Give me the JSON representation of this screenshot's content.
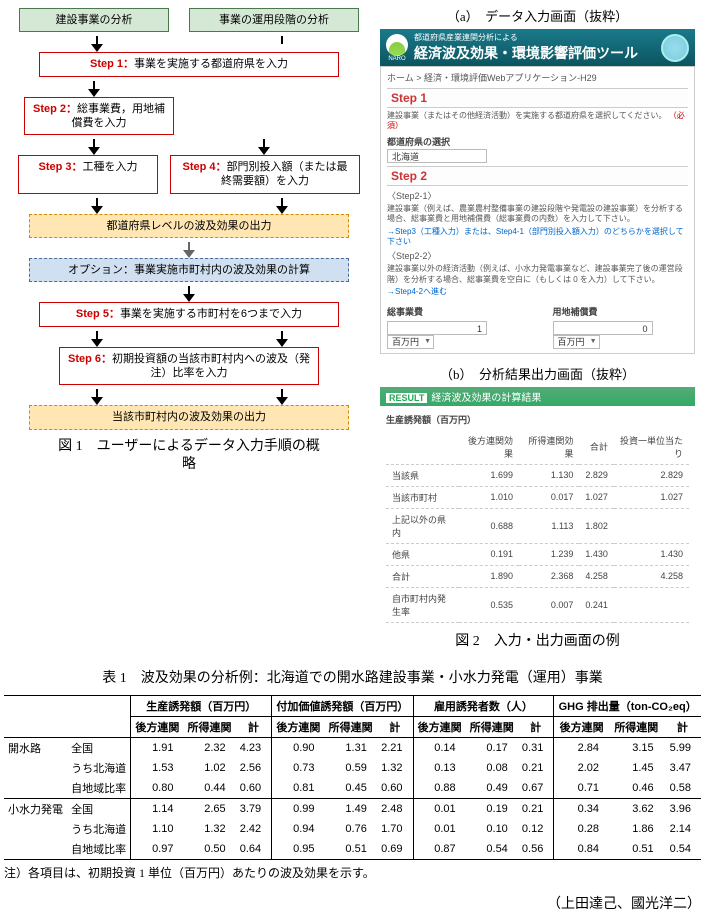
{
  "flowchart": {
    "top_left": "建設事業の分析",
    "top_right": "事業の運用段階の分析",
    "step1_label": "Step 1：",
    "step1_text": "事業を実施する都道府県を入力",
    "step2_label": "Step 2：",
    "step2_text": "総事業費，用地補償費を入力",
    "step3_label": "Step 3：",
    "step3_text": "工種を入力",
    "step4_label": "Step 4：",
    "step4_text": "部門別投入額（または最終需要額）を入力",
    "pref_out": "都道府県レベルの波及効果の出力",
    "option_box": "オプション：事業実施市町村内の波及効果の計算",
    "step5_label": "Step 5：",
    "step5_text": "事業を実施する市町村を6つまで入力",
    "step6_label": "Step 6：",
    "step6_text": "初期投資額の当該市町村内への波及（発注）比率を入力",
    "muni_out": "当該市町村内の波及効果の出力",
    "fig1_caption_line1": "図 1　ユーザーによるデータ入力手順の概",
    "fig1_caption_line2": "略"
  },
  "screenshots": {
    "caption_a": "（a）　データ入力画面（抜粋）",
    "caption_b": "（b）　分析結果出力画面（抜粋）",
    "fig2_caption": "図 2　入力・出力画面の例",
    "logo_text": "NARO",
    "header_sub": "都道府県産業連関分析による",
    "header_title": "経済波及効果・環境影響評価ツール",
    "breadcrumb": "ホーム > 経済・環境評価Webアプリケーション-H29",
    "step1_bar": "Step 1",
    "step1_note": "建設事業（またはその他経済活動）を実施する都道府県を選択してください。",
    "required": "（必須）",
    "pref_label": "都道府県の選択",
    "pref_value": "北海道",
    "step2_bar": "Step 2",
    "s2_sub1_head": "〈Step2-1〉",
    "s2_sub1_text": "建設事業（例えば、農業農村整備事業の建設段階や発電設の建設事業）を分析する場合、総事業費と用地補償費（総事業費の内数）を入力して下さい。",
    "s2_link": "→Step3（工種入力）または、Step4-1（部門別投入額入力）のどちらかを選択して下さい",
    "s2_sub2_head": "〈Step2-2〉",
    "s2_sub2_text": "建設事業以外の経済活動（例えば、小水力発電事業など、建設事業完了後の運営段階）を分析する場合、総事業費を空白に（もしくは 0 を入力）して下さい。",
    "s2_goto": "→Step4-2へ進む",
    "biz_cost_label": "総事業費",
    "biz_cost_value": "1",
    "unit1": "百万円",
    "land_cost_label": "用地補償費",
    "land_cost_value": "0",
    "unit2": "百万円",
    "result_bar_tag": "RESULT",
    "result_bar_title": "経済波及効果の計算結果",
    "result_unit": "生産誘発額（百万円）",
    "cols": [
      "",
      "後方連関効果",
      "所得連関効果",
      "合計",
      "投資一単位当たり"
    ],
    "rows": [
      [
        "当該県",
        "1.699",
        "1.130",
        "2.829",
        "2.829"
      ],
      [
        "当該市町村",
        "1.010",
        "0.017",
        "1.027",
        "1.027"
      ],
      [
        "上記以外の県内",
        "0.688",
        "1.113",
        "1.802",
        ""
      ],
      [
        "他県",
        "0.191",
        "1.239",
        "1.430",
        "1.430"
      ],
      [
        "合計",
        "1.890",
        "2.368",
        "4.258",
        "4.258"
      ],
      [
        "自市町村内発生率",
        "0.535",
        "0.007",
        "0.241",
        ""
      ]
    ]
  },
  "table": {
    "caption": "表 1　波及効果の分析例：北海道での開水路建設事業・小水力発電（運用）事業",
    "group_headers": [
      "生産誘発額（百万円）",
      "付加価値誘発額（百万円）",
      "雇用誘発者数（人）",
      "GHG 排出量（ton-CO₂eq）"
    ],
    "sub_headers": [
      "後方連関",
      "所得連関",
      "計"
    ],
    "row_labels": [
      [
        "開水路",
        "全国"
      ],
      [
        "",
        "うち北海道"
      ],
      [
        "",
        "自地域比率"
      ],
      [
        "小水力発電",
        "全国"
      ],
      [
        "",
        "うち北海道"
      ],
      [
        "",
        "自地域比率"
      ]
    ],
    "data": [
      [
        "1.91",
        "2.32",
        "4.23",
        "0.90",
        "1.31",
        "2.21",
        "0.14",
        "0.17",
        "0.31",
        "2.84",
        "3.15",
        "5.99"
      ],
      [
        "1.53",
        "1.02",
        "2.56",
        "0.73",
        "0.59",
        "1.32",
        "0.13",
        "0.08",
        "0.21",
        "2.02",
        "1.45",
        "3.47"
      ],
      [
        "0.80",
        "0.44",
        "0.60",
        "0.81",
        "0.45",
        "0.60",
        "0.88",
        "0.49",
        "0.67",
        "0.71",
        "0.46",
        "0.58"
      ],
      [
        "1.14",
        "2.65",
        "3.79",
        "0.99",
        "1.49",
        "2.48",
        "0.01",
        "0.19",
        "0.21",
        "0.34",
        "3.62",
        "3.96"
      ],
      [
        "1.10",
        "1.32",
        "2.42",
        "0.94",
        "0.76",
        "1.70",
        "0.01",
        "0.10",
        "0.12",
        "0.28",
        "1.86",
        "2.14"
      ],
      [
        "0.97",
        "0.50",
        "0.64",
        "0.95",
        "0.51",
        "0.69",
        "0.87",
        "0.54",
        "0.56",
        "0.84",
        "0.51",
        "0.54"
      ]
    ],
    "footnote": "注）各項目は、初期投資 1 単位（百万円）あたりの波及効果を示す。"
  },
  "authors": "（上田達己、國光洋二）"
}
